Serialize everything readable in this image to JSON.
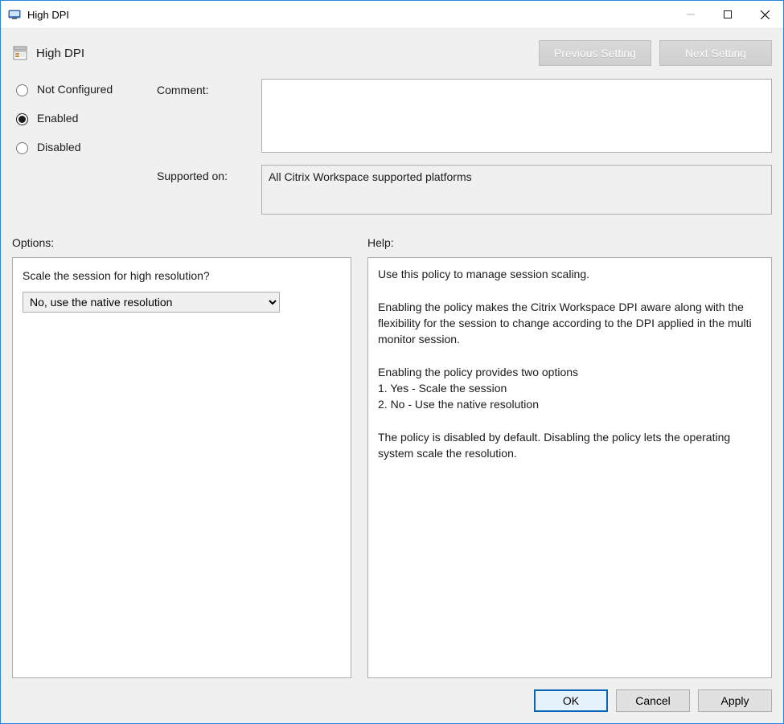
{
  "window": {
    "title": "High DPI"
  },
  "header": {
    "policy_title": "High DPI",
    "prev_label": "Previous Setting",
    "next_label": "Next Setting"
  },
  "radios": {
    "not_configured": "Not Configured",
    "enabled": "Enabled",
    "disabled": "Disabled",
    "selected": "enabled"
  },
  "fields": {
    "comment_label": "Comment:",
    "comment_value": "",
    "supported_label": "Supported on:",
    "supported_value": "All Citrix Workspace supported platforms"
  },
  "sections": {
    "options_label": "Options:",
    "help_label": "Help:"
  },
  "options": {
    "prompt": "Scale the session for high resolution?",
    "selected": "No, use the native resolution"
  },
  "help_text": "Use this policy to manage session scaling.\n\nEnabling the policy makes the Citrix Workspace DPI aware along with the flexibility for the session to change according to the DPI applied in the multi monitor session.\n\nEnabling the policy provides two options\n1. Yes - Scale the session\n2. No - Use the native resolution\n\nThe policy is disabled by default. Disabling the policy lets the operating system scale the resolution.",
  "footer": {
    "ok": "OK",
    "cancel": "Cancel",
    "apply": "Apply"
  }
}
